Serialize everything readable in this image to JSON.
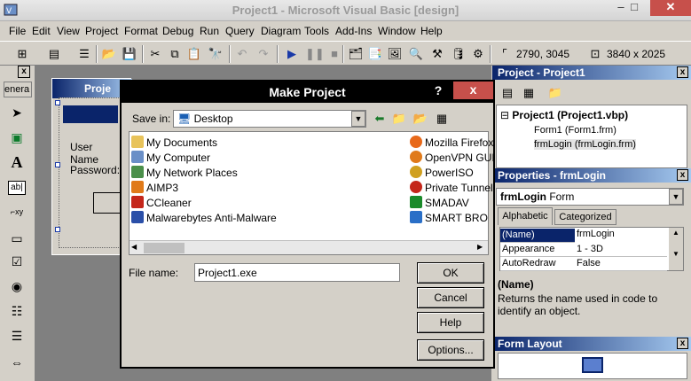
{
  "window": {
    "title": "Project1 - Microsoft Visual Basic [design]",
    "min": "–",
    "max": "□",
    "close": "✕"
  },
  "menu": [
    "File",
    "Edit",
    "View",
    "Project",
    "Format",
    "Debug",
    "Run",
    "Query",
    "Diagram",
    "Tools",
    "Add-Ins",
    "Window",
    "Help"
  ],
  "toolbar": {
    "position": "2790, 3045",
    "size": "3840 x 2025"
  },
  "toolbox": {
    "close": "x",
    "tab_label": "enera"
  },
  "form": {
    "title": "Proje",
    "user_label": "User Name",
    "password_label": "Password:"
  },
  "dialog": {
    "title": "Make Project",
    "help": "?",
    "close": "x",
    "save_in_label": "Save in:",
    "save_in_value": "Desktop",
    "items_left": [
      "My Documents",
      "My Computer",
      "My Network Places",
      "AIMP3",
      "CCleaner",
      "Malwarebytes Anti-Malware"
    ],
    "items_right": [
      "Mozilla Firefox",
      "OpenVPN GUI",
      "PowerISO",
      "Private Tunnel",
      "SMADAV",
      "SMART BRO"
    ],
    "file_name_label": "File name:",
    "file_name_value": "Project1.exe",
    "ok": "OK",
    "cancel": "Cancel",
    "help_button": "Help",
    "options": "Options..."
  },
  "project_panel": {
    "title": "Project - Project1",
    "close": "x",
    "root": "Project1 (Project1.vbp)",
    "items": [
      "Form1 (Form1.frm)",
      "frmLogin (frmLogin.frm)"
    ]
  },
  "properties_panel": {
    "title": "Properties - frmLogin",
    "close": "x",
    "object_name": "frmLogin",
    "object_type": "Form",
    "tabs": [
      "Alphabetic",
      "Categorized"
    ],
    "rows": [
      {
        "name": "(Name)",
        "value": "frmLogin"
      },
      {
        "name": "Appearance",
        "value": "1 - 3D"
      },
      {
        "name": "AutoRedraw",
        "value": "False"
      }
    ],
    "desc_title": "(Name)",
    "desc_text": "Returns the name used in code to identify an object."
  },
  "layout_panel": {
    "title": "Form Layout",
    "close": "x"
  },
  "colors": {
    "caption_active": "#0a246a",
    "close_red": "#c7504b",
    "face": "#d4d0c8"
  }
}
